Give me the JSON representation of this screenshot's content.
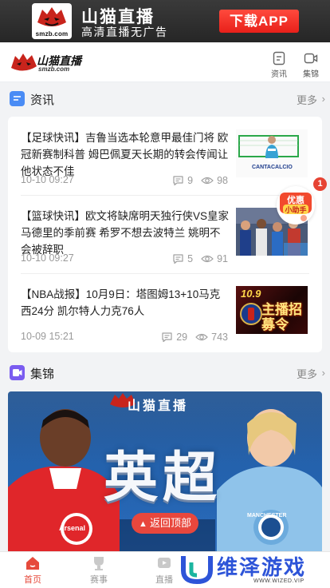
{
  "download_banner": {
    "logo_text": "smzb.com",
    "title": "山猫直播",
    "subtitle": "高清直播无广告",
    "button_label": "下载APP"
  },
  "header": {
    "brand_name": "山猫直播",
    "brand_domain": "smzb.com",
    "actions": [
      {
        "label": "资讯",
        "icon": "document-icon"
      },
      {
        "label": "集锦",
        "icon": "video-icon"
      }
    ]
  },
  "news_section": {
    "title": "资讯",
    "more_label": "更多",
    "items": [
      {
        "title": "【足球快讯】吉鲁当选本轮意甲最佳门将 欧冠新赛制科普 姆巴佩夏天长期的转会传闻让他状态不佳",
        "time": "10-10 09:27",
        "comments": "9",
        "views": "98",
        "thumb_caption": "CANTACALCIO"
      },
      {
        "title": "【篮球快讯】欧文将缺席明天独行侠VS皇家马德里的季前赛 希罗不想去波特兰 姚明不会被辞职",
        "time": "10-10 09:27",
        "comments": "5",
        "views": "91"
      },
      {
        "title": "【NBA战报】10月9日：塔图姆13+10马克西24分 凯尔特人力克76人",
        "time": "10-09 15:21",
        "comments": "29",
        "views": "743",
        "thumb_caption": "10.9",
        "thumb_caption_2": "主播招募令"
      }
    ]
  },
  "highlights_section": {
    "title": "集锦",
    "more_label": "更多",
    "banner_brand": "山猫直播",
    "banner_text": "英超",
    "left_club": "Arsenal",
    "right_club": "MANCHESTER"
  },
  "floating_helper": {
    "label_1": "优惠",
    "label_2": "小助手",
    "badge": "1"
  },
  "back_to_top_label": "返回顶部",
  "tabbar": {
    "tabs": [
      {
        "label": "首页",
        "active": true
      },
      {
        "label": "赛事",
        "active": false
      },
      {
        "label": "直播",
        "active": false
      }
    ]
  },
  "watermark": {
    "text": "维泽游戏",
    "sub": "WWW.WIZED.VIP"
  },
  "colors": {
    "accent_red": "#e64a3c",
    "news_icon_blue": "#4a8cf5",
    "highlight_icon_purple": "#7a5cf0"
  }
}
